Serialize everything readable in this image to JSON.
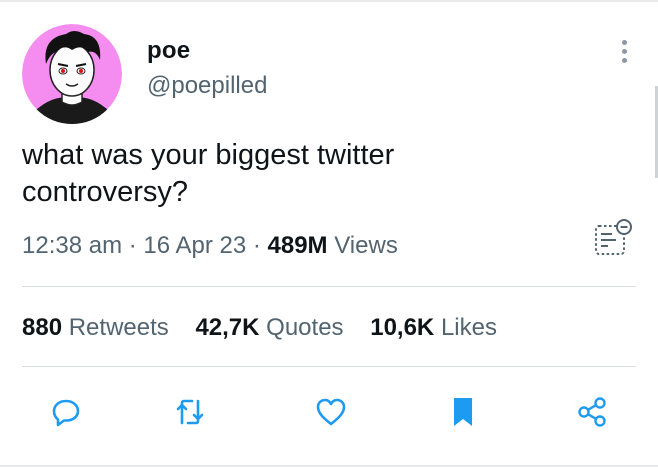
{
  "user": {
    "display_name": "poe",
    "handle": "@poepilled"
  },
  "tweet": {
    "text_line1": "what was your biggest twitter",
    "text_line2": "controversy?",
    "time": "12:38 am",
    "separator": "·",
    "date": "16 Apr 23",
    "views_count": "489M",
    "views_label": "Views"
  },
  "stats": {
    "retweets_count": "880",
    "retweets_label": "Retweets",
    "quotes_count": "42,7K",
    "quotes_label": "Quotes",
    "likes_count": "10,6K",
    "likes_label": "Likes"
  },
  "icons": {
    "more": "more-vertical-icon",
    "analytics": "analytics-icon",
    "reply": "reply-icon",
    "retweet": "retweet-icon",
    "like": "heart-icon",
    "bookmark": "bookmark-icon",
    "share": "share-icon"
  },
  "colors": {
    "accent": "#1d9bf0",
    "text_primary": "#0f1419",
    "text_secondary": "#536471",
    "avatar_bg": "#f58cf0"
  }
}
